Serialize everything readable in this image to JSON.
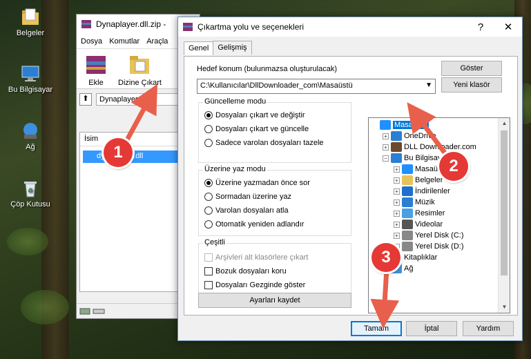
{
  "desktop": {
    "icons": [
      {
        "label": "Belgeler",
        "icon": "folder-documents-icon"
      },
      {
        "label": "Bu Bilgisayar",
        "icon": "computer-icon"
      },
      {
        "label": "Ağ",
        "icon": "network-icon"
      },
      {
        "label": "Çöp Kutusu",
        "icon": "recycle-bin-icon"
      }
    ]
  },
  "winrar": {
    "title": "Dynaplayer.dll.zip -",
    "menu": [
      "Dosya",
      "Komutlar",
      "Araçla"
    ],
    "toolbar": {
      "add": "Ekle",
      "extract": "Dizine Çıkart"
    },
    "path": "Dynaplayer",
    "column_name": "İsim",
    "file": "dynaplayer.dll"
  },
  "dialog": {
    "title": "Çıkartma yolu ve seçenekleri",
    "help": "?",
    "close": "✕",
    "tabs": [
      "Genel",
      "Gelişmiş"
    ],
    "dest_label": "Hedef konum (bulunmazsa oluşturulacak)",
    "dest_value": "C:\\Kullanıcılar\\DllDownloader_com\\Masaüstü",
    "show_button": "Göster",
    "new_folder_button": "Yeni klasör",
    "update_mode": {
      "title": "Güncelleme modu",
      "options": [
        "Dosyaları çıkart ve değiştir",
        "Dosyaları çıkart ve güncelle",
        "Sadece varolan dosyaları tazele"
      ],
      "selected": 0
    },
    "overwrite_mode": {
      "title": "Üzerine yaz modu",
      "options": [
        "Üzerine yazmadan önce sor",
        "Sormadan üzerine yaz",
        "Varolan dosyaları atla",
        "Otomatik yeniden adlandır"
      ],
      "selected": 0
    },
    "misc": {
      "title": "Çeşitli",
      "options": [
        "Arşivleri alt klasörlere çıkart",
        "Bozuk dosyaları koru",
        "Dosyaları Gezginde göster"
      ]
    },
    "save_settings": "Ayarları kaydet",
    "tree": [
      {
        "label": "Masaüstü",
        "level": 0,
        "icon": "desktop-icon",
        "selected": true,
        "expander": ""
      },
      {
        "label": "OneDrive",
        "level": 1,
        "icon": "onedrive-icon",
        "expander": "+"
      },
      {
        "label": "DLL Downloader.com",
        "level": 1,
        "icon": "user-icon",
        "expander": "+"
      },
      {
        "label": "Bu Bilgisayar",
        "level": 1,
        "icon": "computer-icon",
        "expander": "−"
      },
      {
        "label": "Masaüstü",
        "level": 2,
        "icon": "desktop-icon",
        "expander": "+"
      },
      {
        "label": "Belgeler",
        "level": 2,
        "icon": "documents-icon",
        "expander": "+"
      },
      {
        "label": "İndirilenler",
        "level": 2,
        "icon": "downloads-icon",
        "expander": "+"
      },
      {
        "label": "Müzik",
        "level": 2,
        "icon": "music-icon",
        "expander": "+"
      },
      {
        "label": "Resimler",
        "level": 2,
        "icon": "pictures-icon",
        "expander": "+"
      },
      {
        "label": "Videolar",
        "level": 2,
        "icon": "videos-icon",
        "expander": "+"
      },
      {
        "label": "Yerel Disk (C:)",
        "level": 2,
        "icon": "drive-icon",
        "expander": "+"
      },
      {
        "label": "Yerel Disk (D:)",
        "level": 2,
        "icon": "drive-icon",
        "expander": "+"
      },
      {
        "label": "Kitaplıklar",
        "level": 1,
        "icon": "libraries-icon",
        "expander": "+"
      },
      {
        "label": "Ağ",
        "level": 1,
        "icon": "network-icon",
        "expander": "+"
      }
    ],
    "ok": "Tamam",
    "cancel": "İptal",
    "help_button": "Yardım"
  },
  "annotations": [
    "1",
    "2",
    "3"
  ],
  "colors": {
    "accent": "#0078d7",
    "badge": "#e53935",
    "arrow": "#e8604c"
  }
}
